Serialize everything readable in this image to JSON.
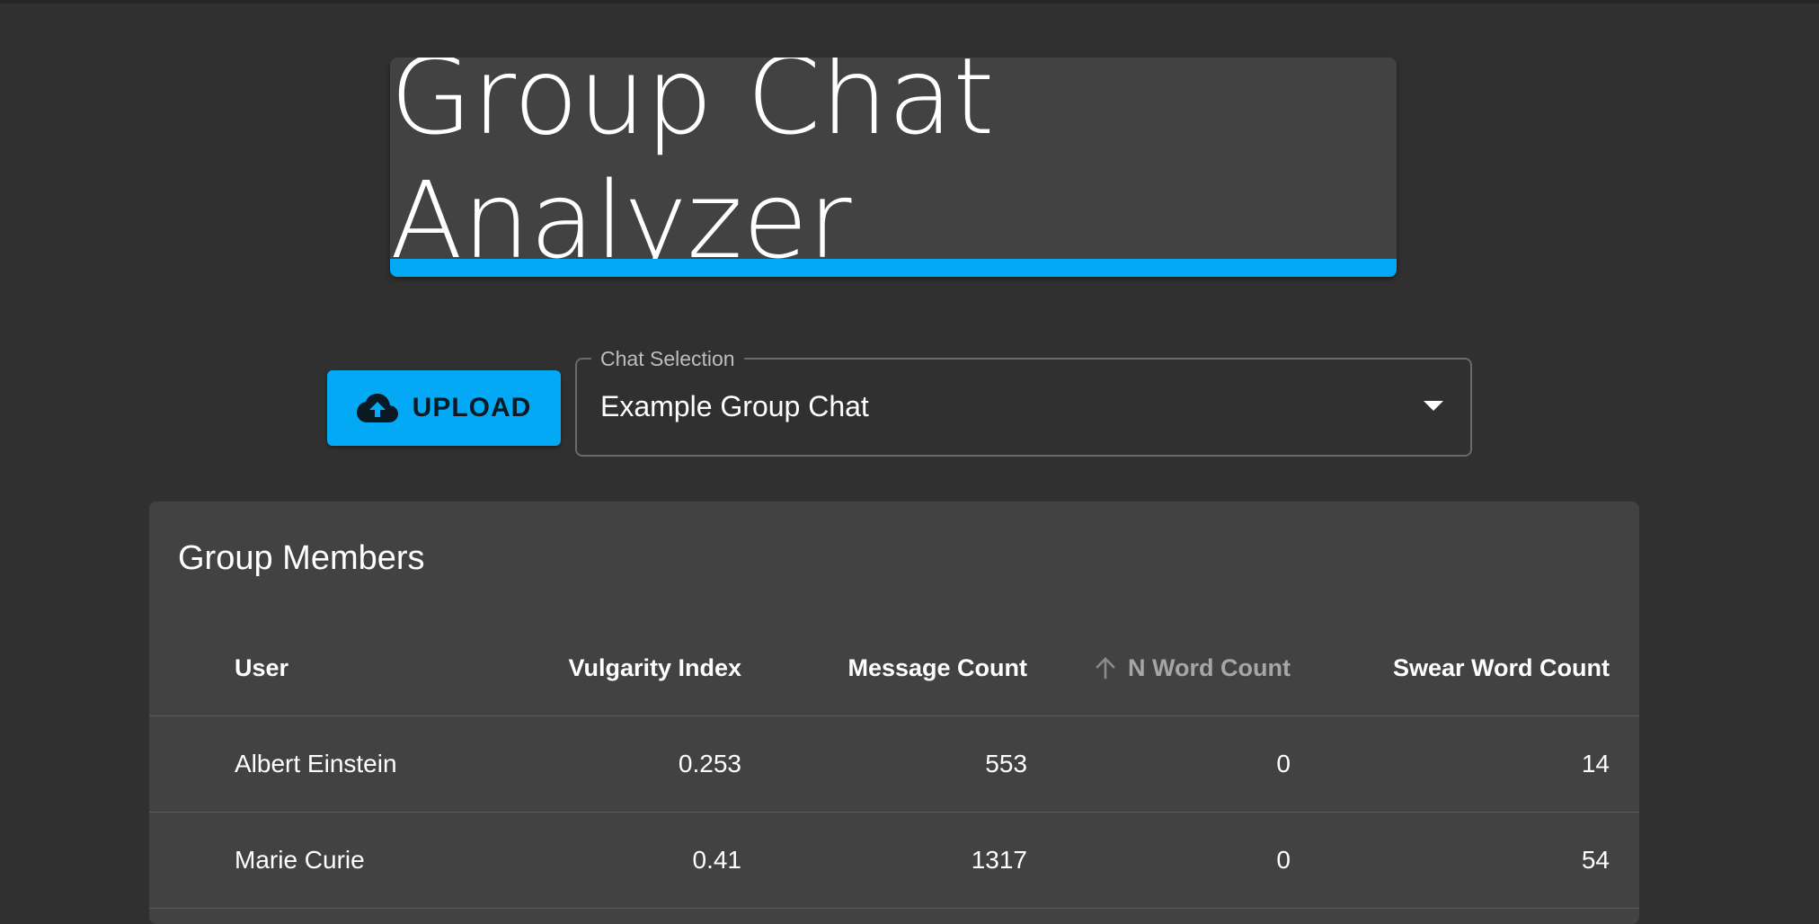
{
  "app": {
    "title": "Group Chat Analyzer",
    "accent_color": "#03a9f4",
    "background_color": "#303030",
    "card_color": "#424242"
  },
  "toolbar": {
    "upload_label": "UPLOAD",
    "upload_icon": "cloud-upload-icon",
    "chat_select": {
      "label": "Chat Selection",
      "value": "Example Group Chat",
      "icon": "dropdown-arrow-icon"
    }
  },
  "members": {
    "title": "Group Members",
    "columns": [
      "User",
      "Vulgarity Index",
      "Message Count",
      "N Word Count",
      "Swear Word Count"
    ],
    "sorted_column": "N Word Count",
    "sort_icon": "arrow-up-icon",
    "rows": [
      {
        "user": "Albert Einstein",
        "vulgarity_index": "0.253",
        "message_count": "553",
        "n_word_count": "0",
        "swear_word_count": "14"
      },
      {
        "user": "Marie Curie",
        "vulgarity_index": "0.41",
        "message_count": "1317",
        "n_word_count": "0",
        "swear_word_count": "54"
      }
    ]
  }
}
